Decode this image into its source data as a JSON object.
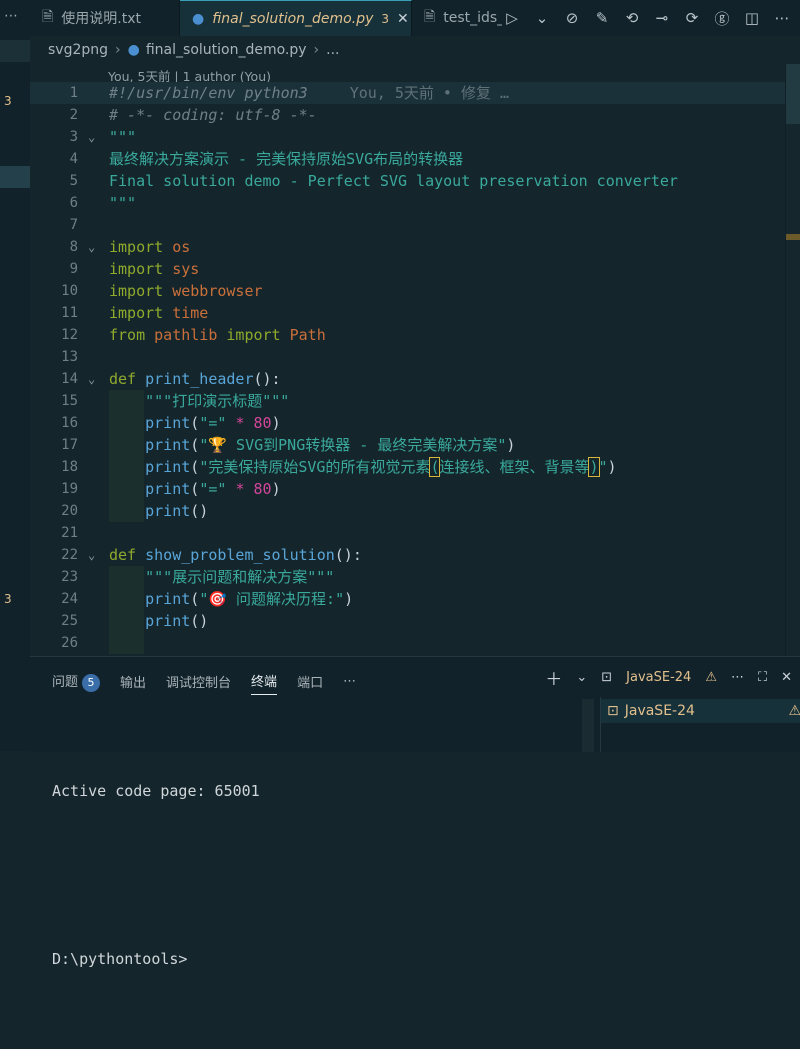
{
  "sidebar_strip": {
    "dots": "⋯",
    "badges": [
      "3",
      "3"
    ]
  },
  "tabs": [
    {
      "icon": "file-text-icon",
      "label": "使用说明.txt",
      "badge": "",
      "active": false
    },
    {
      "icon": "python-icon",
      "label": "final_solution_demo.py",
      "badge": "3",
      "active": true
    },
    {
      "icon": "file-text-icon",
      "label": "test_ids_re",
      "badge": "",
      "active": false
    }
  ],
  "breadcrumb": {
    "folder": "svg2png",
    "file": "final_solution_demo.py",
    "more": "..."
  },
  "blame": "You, 5天前 | 1 author (You)",
  "ghost_blame": "You, 5天前 • 修复 …",
  "code_lines": [
    {
      "n": "1",
      "t": [
        [
          "c",
          "#!/usr/bin/env python3"
        ]
      ]
    },
    {
      "n": "2",
      "t": [
        [
          "c",
          "# -*- coding: utf-8 -*-"
        ]
      ]
    },
    {
      "n": "3",
      "t": [
        [
          "s",
          "\"\"\""
        ]
      ]
    },
    {
      "n": "4",
      "t": [
        [
          "s",
          "最终解决方案演示 - 完美保持原始SVG布局的转换器"
        ]
      ]
    },
    {
      "n": "5",
      "t": [
        [
          "s",
          "Final solution demo - Perfect SVG layout preservation converter"
        ]
      ]
    },
    {
      "n": "6",
      "t": [
        [
          "s",
          "\"\"\""
        ]
      ]
    },
    {
      "n": "7",
      "t": []
    },
    {
      "n": "8",
      "t": [
        [
          "k",
          "import"
        ],
        [
          "p",
          " "
        ],
        [
          "m",
          "os"
        ]
      ]
    },
    {
      "n": "9",
      "t": [
        [
          "k",
          "import"
        ],
        [
          "p",
          " "
        ],
        [
          "m",
          "sys"
        ]
      ]
    },
    {
      "n": "10",
      "t": [
        [
          "k",
          "import"
        ],
        [
          "p",
          " "
        ],
        [
          "m",
          "webbrowser"
        ]
      ]
    },
    {
      "n": "11",
      "t": [
        [
          "k",
          "import"
        ],
        [
          "p",
          " "
        ],
        [
          "m",
          "time"
        ]
      ]
    },
    {
      "n": "12",
      "t": [
        [
          "k",
          "from"
        ],
        [
          "p",
          " "
        ],
        [
          "m",
          "pathlib"
        ],
        [
          "p",
          " "
        ],
        [
          "k",
          "import"
        ],
        [
          "p",
          " "
        ],
        [
          "m",
          "Path"
        ]
      ]
    },
    {
      "n": "13",
      "t": []
    },
    {
      "n": "14",
      "t": [
        [
          "k",
          "def"
        ],
        [
          "p",
          " "
        ],
        [
          "f",
          "print_header"
        ],
        [
          "p",
          "():"
        ]
      ]
    },
    {
      "n": "15",
      "t": [
        [
          "p",
          "    "
        ],
        [
          "s",
          "\"\"\"打印演示标题\"\"\""
        ]
      ]
    },
    {
      "n": "16",
      "t": [
        [
          "p",
          "    "
        ],
        [
          "f",
          "print"
        ],
        [
          "p",
          "("
        ],
        [
          "s",
          "\"=\""
        ],
        [
          "p",
          " "
        ],
        [
          "n",
          "*"
        ],
        [
          "p",
          " "
        ],
        [
          "n",
          "80"
        ],
        [
          "p",
          ")"
        ]
      ]
    },
    {
      "n": "17",
      "t": [
        [
          "p",
          "    "
        ],
        [
          "f",
          "print"
        ],
        [
          "p",
          "("
        ],
        [
          "s",
          "\"🏆 SVG到PNG转换器 - 最终完美解决方案\""
        ],
        [
          "p",
          ")"
        ]
      ]
    },
    {
      "n": "18",
      "t": [
        [
          "p",
          "    "
        ],
        [
          "f",
          "print"
        ],
        [
          "p",
          "("
        ],
        [
          "s",
          "\"完美保持原始SVG的所有视觉元素"
        ],
        [
          "box",
          "("
        ],
        [
          "s",
          "连接线、框架、背景等"
        ],
        [
          "box",
          ")"
        ],
        [
          "s",
          "\""
        ],
        [
          "p",
          ")"
        ]
      ]
    },
    {
      "n": "19",
      "t": [
        [
          "p",
          "    "
        ],
        [
          "f",
          "print"
        ],
        [
          "p",
          "("
        ],
        [
          "s",
          "\"=\""
        ],
        [
          "p",
          " "
        ],
        [
          "n",
          "*"
        ],
        [
          "p",
          " "
        ],
        [
          "n",
          "80"
        ],
        [
          "p",
          ")"
        ]
      ]
    },
    {
      "n": "20",
      "t": [
        [
          "p",
          "    "
        ],
        [
          "f",
          "print"
        ],
        [
          "p",
          "()"
        ]
      ]
    },
    {
      "n": "21",
      "t": []
    },
    {
      "n": "22",
      "t": [
        [
          "k",
          "def"
        ],
        [
          "p",
          " "
        ],
        [
          "f",
          "show_problem_solution"
        ],
        [
          "p",
          "():"
        ]
      ]
    },
    {
      "n": "23",
      "t": [
        [
          "p",
          "    "
        ],
        [
          "s",
          "\"\"\"展示问题和解决方案\"\"\""
        ]
      ]
    },
    {
      "n": "24",
      "t": [
        [
          "p",
          "    "
        ],
        [
          "f",
          "print"
        ],
        [
          "p",
          "("
        ],
        [
          "s",
          "\"🎯 问题解决历程:\""
        ],
        [
          "p",
          ")"
        ]
      ]
    },
    {
      "n": "25",
      "t": [
        [
          "p",
          "    "
        ],
        [
          "f",
          "print"
        ],
        [
          "p",
          "()"
        ]
      ]
    },
    {
      "n": "26",
      "t": []
    }
  ],
  "panel": {
    "tabs": [
      {
        "label": "问题",
        "count": "5",
        "selected": false
      },
      {
        "label": "输出",
        "count": "",
        "selected": false
      },
      {
        "label": "调试控制台",
        "count": "",
        "selected": false
      },
      {
        "label": "终端",
        "count": "",
        "selected": true
      },
      {
        "label": "端口",
        "count": "",
        "selected": false
      }
    ],
    "more": "⋯",
    "terminal_name": "JavaSE-24",
    "terminal_lines": [
      "Active code page: 65001",
      "",
      "D:\\pythontools>"
    ],
    "terminal_list_item": "JavaSE-24"
  },
  "colors": {
    "background": "#14262c",
    "keyword": "#8fa92c",
    "module": "#c96f3a",
    "function": "#5aa5d8",
    "string": "#3aa99c",
    "number": "#d3469a",
    "accent": "#e2c08d"
  }
}
